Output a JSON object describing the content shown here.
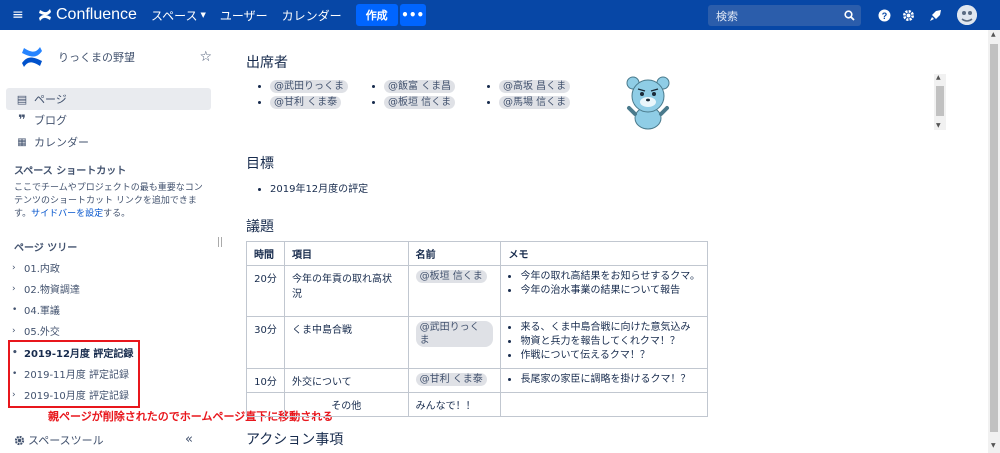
{
  "topnav": {
    "product": "Confluence",
    "links": [
      "スペース",
      "ユーザー",
      "カレンダー"
    ],
    "create_label": "作成",
    "more_label": "•••",
    "search_placeholder": "検索"
  },
  "sidebar": {
    "space_name": "りっくまの野望",
    "nav": [
      {
        "label": "ページ",
        "icon": "page-icon"
      },
      {
        "label": "ブログ",
        "icon": "quote-icon"
      },
      {
        "label": "カレンダー",
        "icon": "calendar-icon"
      }
    ],
    "shortcut_heading": "スペース ショートカット",
    "shortcut_text": "ここでチームやプロジェクトの最も重要なコンテンツのショートカット リンクを追加できます。",
    "shortcut_link": "サイドバーを設定",
    "shortcut_suffix": "する。",
    "tree_heading": "ページ ツリー",
    "tree": [
      {
        "label": "01.内政",
        "marker": "›"
      },
      {
        "label": "02.物資調達",
        "marker": "›"
      },
      {
        "label": "04.軍議",
        "marker": "•"
      },
      {
        "label": "05.外交",
        "marker": "›"
      },
      {
        "label": "2019-12月度 評定記録",
        "marker": "•",
        "bold": true
      },
      {
        "label": "2019-11月度 評定記録",
        "marker": "•"
      },
      {
        "label": "2019-10月度 評定記録",
        "marker": "›"
      }
    ],
    "annotation": "親ページが削除されたのでホームページ直下に移動される",
    "space_tools": "スペースツール",
    "collapse": "«"
  },
  "main": {
    "attendees_heading": "出席者",
    "attendees": [
      [
        "@武田りっくま",
        "@甘利 くま泰"
      ],
      [
        "@飯富 くま昌",
        "@板垣 信くま"
      ],
      [
        "@高坂 昌くま",
        "@馬場 信くま"
      ]
    ],
    "goal_heading": "目標",
    "goals": [
      "2019年12月度の評定"
    ],
    "agenda_heading": "議題",
    "agenda_columns": [
      "時間",
      "項目",
      "名前",
      "メモ"
    ],
    "agenda_rows": [
      {
        "time": "20分",
        "item": "今年の年貢の取れ高状況",
        "name": "@板垣 信くま",
        "mention": true,
        "notes": [
          "今年の取れ高結果をお知らせするクマ。",
          "今年の治水事業の結果について報告"
        ]
      },
      {
        "time": "30分",
        "item": "くま中島合戦",
        "name": "@武田りっくま",
        "mention": true,
        "notes": [
          "来る、くま中島合戦に向けた意気込み",
          "物資と兵力を報告してくれクマ！？",
          "作戦について伝えるクマ！？"
        ]
      },
      {
        "time": "10分",
        "item": "外交について",
        "name": "@甘利 くま泰",
        "mention": true,
        "notes": [
          "長尾家の家臣に調略を掛けるクマ！？"
        ]
      },
      {
        "time": "",
        "item": "その他",
        "name": "みんなで！！",
        "mention": false,
        "notes": []
      }
    ],
    "action_heading": "アクション事項"
  },
  "colors": {
    "topbar": "#0747a6",
    "create_button": "#0065ff",
    "annotation_red": "#e8161c",
    "link": "#0052cc"
  }
}
